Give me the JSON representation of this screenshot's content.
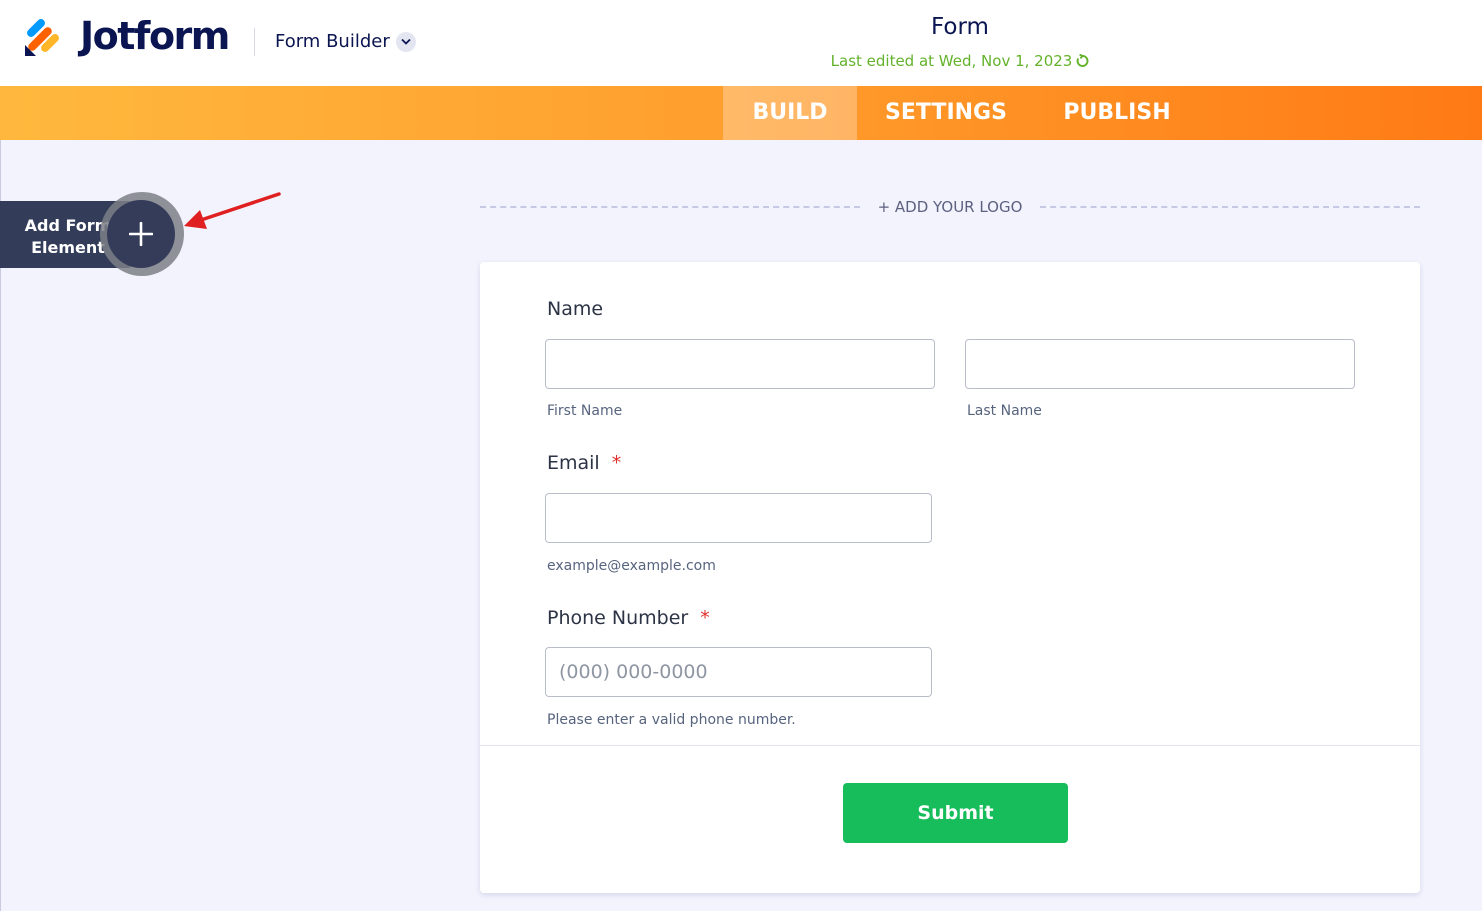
{
  "header": {
    "brand": "Jotform",
    "builder_label": "Form Builder",
    "form_title": "Form",
    "last_edited": "Last edited at Wed, Nov 1, 2023"
  },
  "nav": {
    "tabs": [
      {
        "label": "BUILD",
        "active": true
      },
      {
        "label": "SETTINGS",
        "active": false
      },
      {
        "label": "PUBLISH",
        "active": false
      }
    ]
  },
  "sidebar": {
    "add_element_line1": "Add Form",
    "add_element_line2": "Element"
  },
  "form": {
    "add_logo": "+ ADD YOUR LOGO",
    "name": {
      "label": "Name",
      "first_value": "",
      "last_value": "",
      "first_sublabel": "First Name",
      "last_sublabel": "Last Name"
    },
    "email": {
      "label": "Email",
      "required_mark": "*",
      "value": "",
      "sublabel": "example@example.com"
    },
    "phone": {
      "label": "Phone Number",
      "required_mark": "*",
      "placeholder": "(000) 000-0000",
      "sublabel": "Please enter a valid phone number."
    },
    "submit_label": "Submit"
  },
  "colors": {
    "brand_navy": "#0a1551",
    "edited_green": "#64b22b",
    "submit_green": "#18bd5b",
    "nav_orange_start": "#ffb83d",
    "nav_orange_end": "#ff7a14",
    "required_red": "#e0312d"
  },
  "icons": {
    "logo": "jotform-logo-icon",
    "builder_dropdown": "chevron-down-icon",
    "refresh": "refresh-icon",
    "add": "plus-icon",
    "annotation": "red-arrow-icon"
  }
}
